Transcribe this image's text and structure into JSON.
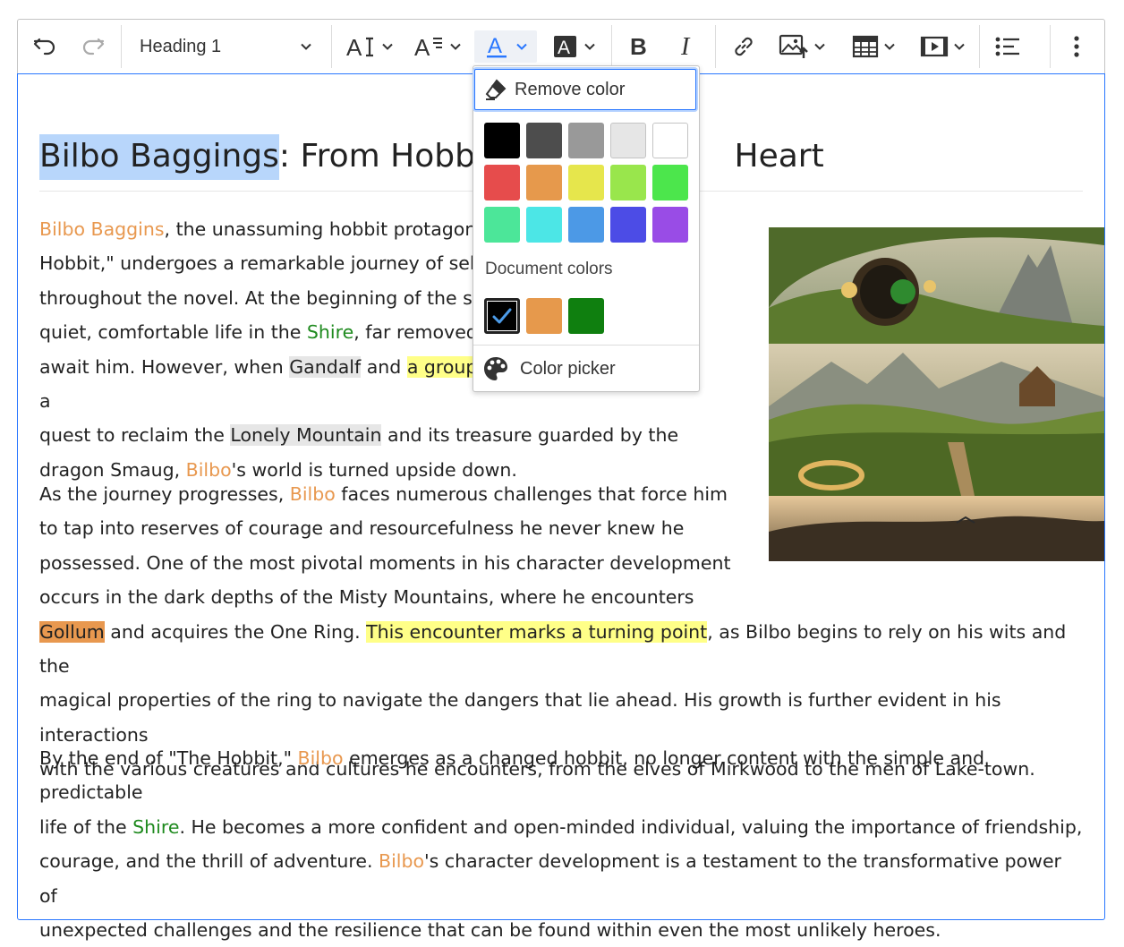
{
  "toolbar": {
    "heading_value": "Heading 1",
    "colors": {
      "accent": "#2977ff",
      "icon": "#333333"
    }
  },
  "document": {
    "heading": {
      "selected": "Bilbo Baggings",
      "rest": ": From Hobbit ",
      "hidden_end": "Heart"
    },
    "p1": {
      "l1a": "Bilbo Baggins",
      "l1b": ", the unassuming hobbit protagonis",
      "l2": "Hobbit,\" undergoes a remarkable journey of self-",
      "l3": "throughout the novel. At the beginning of the sto",
      "l4a": "quiet, comfortable life in the ",
      "l4b": "Shire",
      "l4c": ", far removed f",
      "l5a": "await him. However, when ",
      "l5b": "Gandalf",
      "l5c": " and ",
      "l5d": "a group o",
      "l5e": "a",
      "l6a": "quest to reclaim the ",
      "l6b": "Lonely Mountain",
      "l6c": " and its treasure guarded by the",
      "l7a": "dragon Smaug, ",
      "l7b": "Bilbo",
      "l7c": "'s world is turned upside down."
    },
    "p2": {
      "l1a": "As the journey progresses, ",
      "l1b": "Bilbo",
      "l1c": " faces numerous challenges that force him",
      "l2": "to tap into reserves of courage and resourcefulness he never knew he",
      "l3": "possessed. One of the most pivotal moments in his character development",
      "l4": "occurs in the dark depths of the Misty Mountains, where he encounters",
      "l5a": "Gollum",
      "l5b": " and acquires the One Ring. ",
      "l5c": "This encounter marks a turning point",
      "l5d": ", as Bilbo begins to rely on his wits and the",
      "l6": "magical properties of the ring to navigate the dangers that lie ahead. His growth is further evident in his interactions",
      "l7": "with the various creatures and cultures he encounters, from the elves of Mirkwood to the men of Lake-town."
    },
    "p3": {
      "l1a": "By the end of \"The Hobbit,\" ",
      "l1b": "Bilbo",
      "l1c": " emerges as a changed hobbit, no longer content with the simple and predictable",
      "l2a": "life of the ",
      "l2b": "Shire",
      "l2c": ". He becomes a more confident and open-minded individual, valuing the importance of friendship,",
      "l3a": "courage, and the thrill of adventure. ",
      "l3b": "Bilbo",
      "l3c": "'s character development is a testament to the transformative power of",
      "l4": "unexpected challenges and the resilience that can be found within even the most unlikely heroes."
    }
  },
  "color_popup": {
    "remove_label": "Remove color",
    "document_colors_label": "Document colors",
    "color_picker_label": "Color picker",
    "palette": [
      "#000000",
      "#4d4d4d",
      "#999999",
      "#e6e6e6",
      "#ffffff",
      "#e64c4c",
      "#e6994c",
      "#e6e64c",
      "#99e64c",
      "#4ce64c",
      "#4ce699",
      "#4ce6e6",
      "#4c99e6",
      "#4c4ce6",
      "#994ce6"
    ],
    "document_colors": [
      "#000000",
      "#e6994c",
      "#0f7f0f"
    ],
    "selected_document_color": "#000000"
  }
}
